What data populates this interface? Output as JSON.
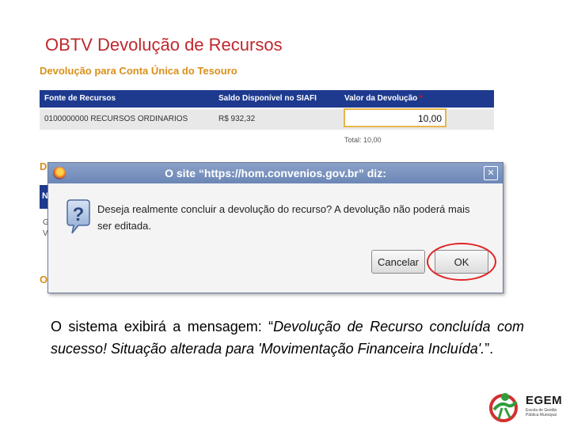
{
  "slide": {
    "title": "OBTV Devolução de Recursos",
    "body_plain": "O sistema exibirá a mensagem: “",
    "body_italic": "Devolução de Recurso concluída com sucesso! Situação alterada para 'Movimentação Financeira Incluída'.",
    "body_end": "”."
  },
  "panel": {
    "section_title": "Devolução para Conta Única do Tesouro",
    "columns": [
      "Fonte de Recursos",
      "Saldo Disponível no SIAFI",
      "Valor da Devolução"
    ],
    "required_mark": "*",
    "row": [
      "0100000000 RECURSOS ORDINARIOS",
      "R$ 932,32"
    ],
    "value_input": "10,00",
    "total_label": "Total: 10,00",
    "peek_letters": [
      "D",
      "N",
      "G",
      "V",
      "O"
    ]
  },
  "dialog": {
    "title": "O site “https://hom.convenios.gov.br” diz:",
    "message": "Deseja realmente concluir a devolução do recurso? A devolução não poderá mais ser editada.",
    "cancel_label": "Cancelar",
    "ok_label": "OK",
    "icons": [
      "firefox-icon",
      "question-icon",
      "close-icon"
    ]
  },
  "logo": {
    "name": "EGEM",
    "subtitle": "Escola de Gestão Pública Municipal"
  },
  "colors": {
    "title_red": "#c0282d",
    "header_blue": "#1d3a8e",
    "section_orange": "#d8901a",
    "highlight_red": "#e02424"
  }
}
